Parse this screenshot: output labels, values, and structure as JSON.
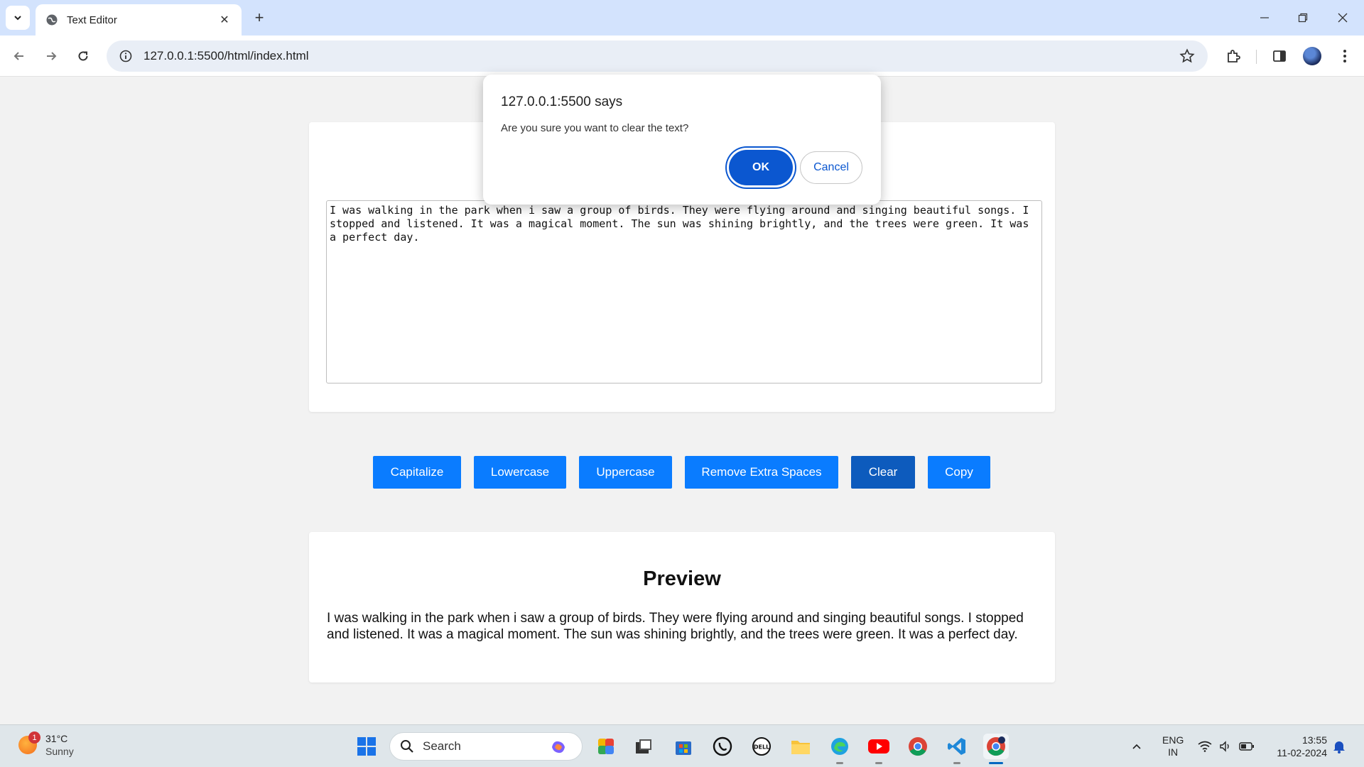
{
  "browser": {
    "tab_title": "Text Editor",
    "url": "127.0.0.1:5500/html/index.html"
  },
  "editor": {
    "text": "I was walking in the park when i saw a group of birds. They were flying around and singing beautiful songs. I stopped and listened. It was a magical moment. The sun was shining brightly, and the trees were green. It was a perfect day."
  },
  "actions": {
    "capitalize": "Capitalize",
    "lowercase": "Lowercase",
    "uppercase": "Uppercase",
    "remove_spaces": "Remove Extra Spaces",
    "clear": "Clear",
    "copy": "Copy"
  },
  "preview": {
    "title": "Preview",
    "text": "I was walking in the park when i saw a group of birds. They were flying around and singing beautiful songs. I stopped and listened. It was a magical moment. The sun was shining brightly, and the trees were green. It was a perfect day."
  },
  "dialog": {
    "title": "127.0.0.1:5500 says",
    "message": "Are you sure you want to clear the text?",
    "ok": "OK",
    "cancel": "Cancel"
  },
  "taskbar": {
    "weather_temp": "31°C",
    "weather_desc": "Sunny",
    "weather_badge": "1",
    "search_placeholder": "Search",
    "lang_top": "ENG",
    "lang_bottom": "IN",
    "time": "13:55",
    "date": "11-02-2024"
  },
  "colors": {
    "action_button": "#0a7cff",
    "action_button_active": "#0d5bbd",
    "dialog_accent": "#0b57d0",
    "tabbar": "#d3e3fd"
  }
}
